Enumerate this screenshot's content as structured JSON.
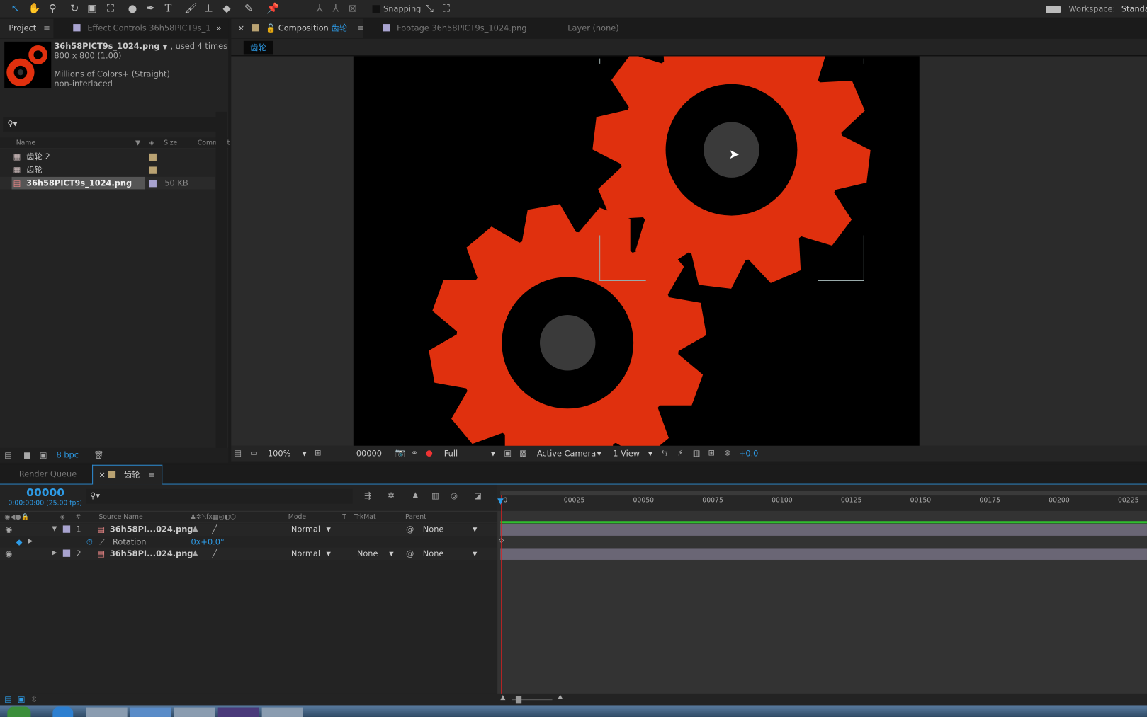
{
  "toolbar": {
    "tools": [
      "selection-tool",
      "hand-tool",
      "zoom-tool",
      "rotate-tool",
      "camera-tool",
      "pan-behind-tool",
      "ellipse-tool",
      "pen-tool",
      "type-tool",
      "brush-tool",
      "clone-stamp-tool",
      "eraser-tool",
      "roto-brush-tool",
      "puppet-pin-tool"
    ],
    "snapping": "Snapping",
    "workspace_label": "Workspace:",
    "workspace_value": "Standa"
  },
  "project": {
    "tab": "Project",
    "effect_controls_tab": "Effect Controls 36h58PICT9s_1",
    "file_name": "36h58PICT9s_1024.png",
    "used": ", used 4 times",
    "dimensions": "800 x 800 (1.00)",
    "colors": "Millions of Colors+ (Straight)",
    "interlace": "non-interlaced",
    "columns": {
      "name": "Name",
      "size": "Size",
      "comment": "Comment"
    },
    "items": [
      {
        "name": "齿轮 2",
        "size": "",
        "type": "composition"
      },
      {
        "name": "齿轮",
        "size": "",
        "type": "composition"
      },
      {
        "name": "36h58PICT9s_1024.png",
        "size": "50 KB",
        "type": "footage"
      }
    ],
    "bpc": "8 bpc"
  },
  "viewer": {
    "composition_tab": "Composition",
    "comp_name": "齿轮",
    "footage_tab": "Footage 36h58PICT9s_1024.png",
    "layer_tab": "Layer (none)",
    "breadcrumb": "齿轮",
    "zoom": "100%",
    "timecode": "00000",
    "resolution": "Full",
    "camera": "Active Camera",
    "views": "1 View",
    "exposure": "+0.0",
    "colors": {
      "gear": "#e0300e",
      "background": "#000000",
      "hub": "#3a3a3a"
    }
  },
  "timeline": {
    "render_queue_tab": "Render Queue",
    "comp_tab": "齿轮",
    "current_frame": "00000",
    "timecode": "0:00:00:00 (25.00 fps)",
    "columns": {
      "num": "#",
      "source_name": "Source Name",
      "mode": "Mode",
      "t": "T",
      "trkmat": "TrkMat",
      "parent": "Parent"
    },
    "ruler": [
      "0",
      "00025",
      "00050",
      "00075",
      "00100",
      "00125",
      "00150",
      "00175",
      "00200",
      "00225"
    ],
    "layers": [
      {
        "index": "1",
        "name": "36h58PI...024.png",
        "mode": "Normal",
        "trkmat": "",
        "parent": "None",
        "expanded": true
      },
      {
        "index": "2",
        "name": "36h58PI...024.png",
        "mode": "Normal",
        "trkmat": "None",
        "parent": "None",
        "expanded": false
      }
    ],
    "property": {
      "name": "Rotation",
      "value": "0x+0.0°"
    }
  }
}
